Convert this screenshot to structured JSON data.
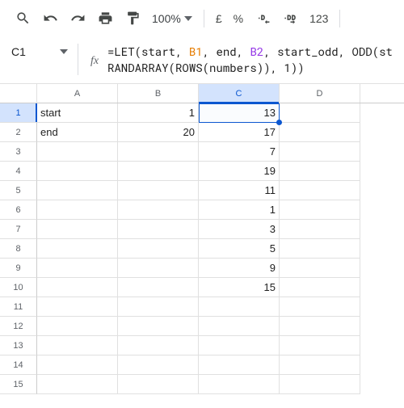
{
  "toolbar": {
    "zoom": "100%",
    "currency": "£",
    "percent": "%",
    "numfmt": "123"
  },
  "namebox": {
    "value": "C1"
  },
  "formula": {
    "prefix1": "=LET(start, ",
    "ref1": "B1",
    "mid1": ", end, ",
    "ref2": "B2",
    "mid2": ", start_odd, ODD(st",
    "prefix2": "RANDARRAY(ROWS(numbers)), 1))"
  },
  "columns": [
    "A",
    "B",
    "C",
    "D"
  ],
  "sel_col_index": 2,
  "sel_row_index": 0,
  "row_count": 15,
  "cells": {
    "r1": {
      "A": "start",
      "B": "1",
      "C": "13"
    },
    "r2": {
      "A": "end",
      "B": "20",
      "C": "17"
    },
    "r3": {
      "C": "7"
    },
    "r4": {
      "C": "19"
    },
    "r5": {
      "C": "11"
    },
    "r6": {
      "C": "1"
    },
    "r7": {
      "C": "3"
    },
    "r8": {
      "C": "5"
    },
    "r9": {
      "C": "9"
    },
    "r10": {
      "C": "15"
    }
  }
}
